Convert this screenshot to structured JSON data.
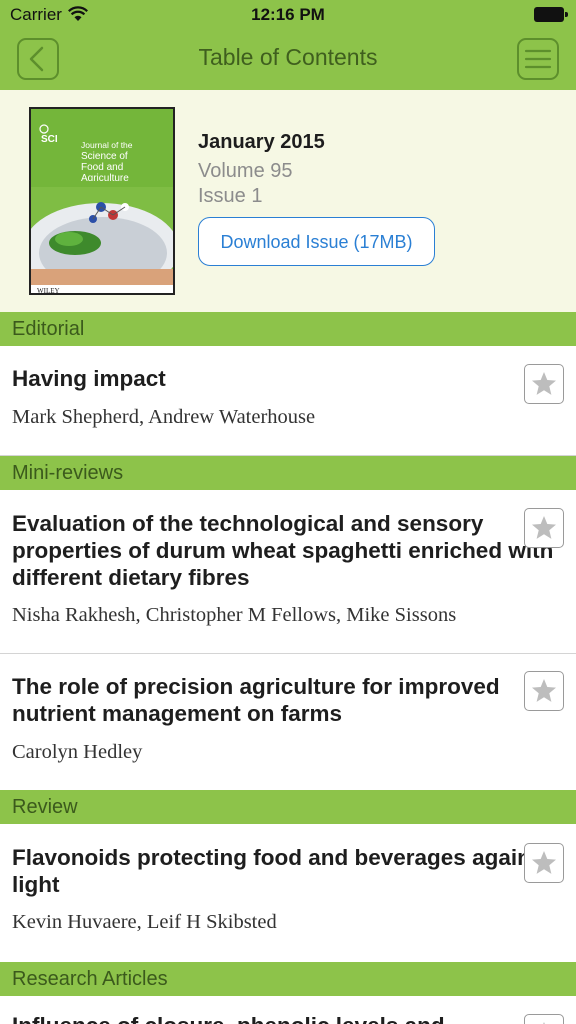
{
  "status_bar": {
    "carrier": "Carrier",
    "time": "12:16 PM"
  },
  "nav": {
    "title": "Table of Contents",
    "back_icon": "chevron-left-icon",
    "menu_icon": "hamburger-menu-icon"
  },
  "issue": {
    "date": "January 2015",
    "volume": "Volume 95",
    "issue": "Issue 1",
    "download_label": "Download Issue (17MB)",
    "cover_logo": "SCI",
    "cover_title": "Journal of the Science of Food and Agriculture",
    "cover_publisher": "WILEY"
  },
  "sections": {
    "editorial": "Editorial",
    "mini_reviews": "Mini-reviews",
    "review": "Review",
    "research": "Research Articles"
  },
  "articles": [
    {
      "title": "Having impact",
      "authors": "Mark Shepherd, Andrew Waterhouse"
    },
    {
      "title": "Evaluation of the technological and sensory properties of durum wheat spaghetti enriched with different dietary fibres",
      "authors": "Nisha Rakhesh, Christopher M Fellows, Mike Sissons"
    },
    {
      "title": "The role of precision agriculture for improved nutrient management on farms",
      "authors": "Carolyn Hedley"
    },
    {
      "title": "Flavonoids protecting food and beverages against light",
      "authors": "Kevin Huvaere, Leif H Skibsted"
    },
    {
      "title": "Influence of closure, phenolic levels and"
    }
  ],
  "colors": {
    "brand_green": "#8dc34a",
    "header_bg": "#f6f8e4",
    "link_blue": "#2a7fd4"
  }
}
